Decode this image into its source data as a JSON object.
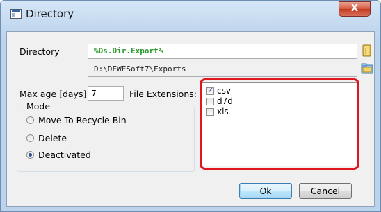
{
  "window": {
    "title": "Directory",
    "close_label": "X"
  },
  "directory": {
    "label": "Directory",
    "variable_value": "%Ds.Dir.Export%",
    "resolved_path": "D:\\DEWESoft7\\Exports"
  },
  "max_age": {
    "label": "Max age [days]",
    "value": "7"
  },
  "mode": {
    "title": "Mode",
    "options": [
      {
        "label": "Move To Recycle Bin",
        "selected": false
      },
      {
        "label": "Delete",
        "selected": false
      },
      {
        "label": "Deactivated",
        "selected": true
      }
    ]
  },
  "file_extensions": {
    "label": "File Extensions:",
    "items": [
      {
        "label": "csv",
        "checked": true
      },
      {
        "label": "d7d",
        "checked": false
      },
      {
        "label": "xls",
        "checked": false
      }
    ],
    "highlight_color": "#e0161e"
  },
  "buttons": {
    "ok": "Ok",
    "cancel": "Cancel"
  }
}
